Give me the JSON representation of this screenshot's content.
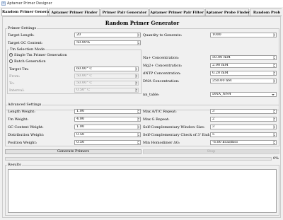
{
  "window": {
    "title": "Aptamer Primer Designer"
  },
  "tabs": [
    {
      "label": "Random Primer Generator",
      "active": true
    },
    {
      "label": "Aptamer Primer Finder",
      "active": false
    },
    {
      "label": "Primer Pair Generator",
      "active": false
    },
    {
      "label": "Aptamer Primer Pair Filter",
      "active": false
    },
    {
      "label": "Aptamer Probe Finder",
      "active": false
    },
    {
      "label": "Random Prob",
      "active": false
    }
  ],
  "page": {
    "heading": "Random Primer Generator"
  },
  "primer_settings": {
    "title": "Primer Settings",
    "target_length_label": "Target Length:",
    "target_length_value": "20",
    "quantity_label": "Quantity to Generate:",
    "quantity_value": "1000",
    "target_gc_label": "Target GC Content:",
    "target_gc_value": "50.00%"
  },
  "tm_mode": {
    "title": "Tm Selection Mode",
    "option_single": "Single Tm Primer Generation",
    "option_batch": "Batch Generation",
    "selected": "single",
    "target_tm_label": "Target Tm:",
    "target_tm_value": "60.00° C",
    "from_label": "From:",
    "from_value": "50.00° C",
    "to_label": "To:",
    "to_value": "50.00° C",
    "interval_label": "Interval:",
    "interval_value": "0.50° C"
  },
  "concentrations": {
    "na_label": "Na+ Concentration:",
    "na_value": "50.00 mM",
    "mg_label": "Mg2+ Concentration:",
    "mg_value": "2.00 mM",
    "dntp_label": "dNTP Concentration:",
    "dntp_value": "0.20 mM",
    "dna_label": "DNA Concentration:",
    "dna_value": "250.00 nM",
    "nn_table_label": "nn_table:",
    "nn_table_value": "DNA_NN4"
  },
  "advanced": {
    "title": "Advanced Settings",
    "length_weight_label": "Length Weight:",
    "length_weight_value": "1.00",
    "tm_weight_label": "Tm Weight:",
    "tm_weight_value": "4.00",
    "gc_weight_label": "GC Content Weight:",
    "gc_weight_value": "1.00",
    "distribution_weight_label": "Distribution Weight:",
    "distribution_weight_value": "0.50",
    "position_weight_label": "Position Weight:",
    "position_weight_value": "0.50",
    "max_at_label": "Max A/T/C Repeat:",
    "max_at_value": "3",
    "max_g_label": "Max G Repeat:",
    "max_g_value": "2",
    "self_comp_window_label": "Self-Complementary Window Size:",
    "self_comp_window_value": "3",
    "self_comp_3end_label": "Self-Complementary Check of 3' End:",
    "self_comp_3end_value": "5",
    "min_dg_label": "Min Homodimer ΔG:",
    "min_dg_value": "-6.00 kcal/mol"
  },
  "actions": {
    "generate_label": "Generate Primers",
    "stop_label": "Stop",
    "progress_text": "0%",
    "progress_fraction": 0
  },
  "results": {
    "title": "Results"
  }
}
